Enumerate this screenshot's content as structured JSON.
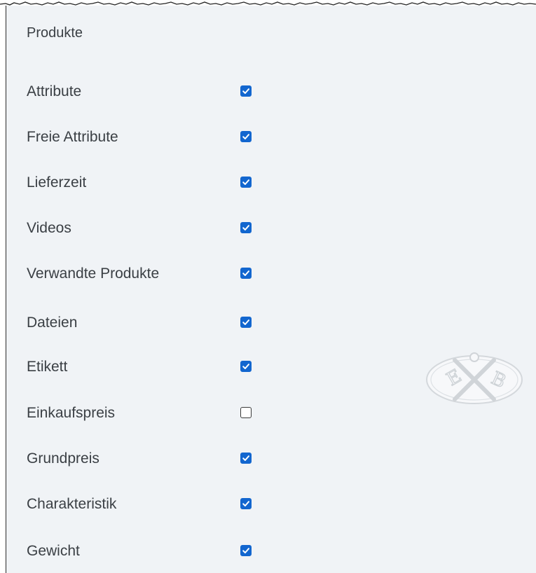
{
  "section": {
    "title": "Produkte"
  },
  "options": [
    {
      "label": "Attribute",
      "checked": true
    },
    {
      "label": "Freie Attribute",
      "checked": true
    },
    {
      "label": "Lieferzeit",
      "checked": true
    },
    {
      "label": "Videos",
      "checked": true
    },
    {
      "label": "Verwandte Produkte",
      "checked": true
    },
    {
      "label": "Dateien",
      "checked": true
    },
    {
      "label": "Etikett",
      "checked": true
    },
    {
      "label": "Einkaufspreis",
      "checked": false
    },
    {
      "label": "Grundpreis",
      "checked": true
    },
    {
      "label": "Charakteristik",
      "checked": true
    },
    {
      "label": "Gewicht",
      "checked": true
    }
  ],
  "seal": {
    "letters": [
      "E",
      "X",
      "B"
    ]
  },
  "colors": {
    "panel_background": "#f0f3f6",
    "checkbox_accent": "#1266cf",
    "text": "#3a3f44"
  },
  "icons": {
    "checkbox_checked": "check-mark-icon",
    "watermark": "seal-logo"
  }
}
